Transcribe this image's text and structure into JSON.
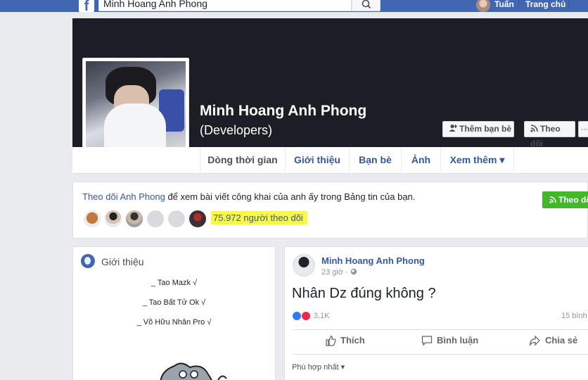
{
  "topbar": {
    "logo": "f",
    "search_value": "Minh Hoang Anh Phong",
    "user_name": "Tuấn",
    "home_label": "Trang chủ",
    "brand_color": "#4267b2"
  },
  "profile": {
    "name": "Minh Hoang Anh Phong",
    "subtitle": "(Developers)",
    "add_friend_label": "Thêm bạn bè",
    "follow_label": "Theo dõi",
    "more_label": "···"
  },
  "tabs": [
    {
      "label": "Dòng thời gian"
    },
    {
      "label": "Giới thiệu"
    },
    {
      "label": "Bạn bè"
    },
    {
      "label": "Ảnh"
    },
    {
      "label": "Xem thêm ▾"
    }
  ],
  "follow_bar": {
    "link_text": "Theo dõi Anh Phong",
    "text": " để xem bài viết công khai của anh ấy trong Bảng tin của bạn.",
    "button_label": "Theo dõi",
    "followers_text": "75.972 người theo dõi",
    "highlight_color": "#fbf74a",
    "button_color": "#42b72a"
  },
  "intro": {
    "title": "Giới thiệu",
    "lines": [
      "_ Tao Mazk √",
      "_ Tao Bất Tử Ok √",
      "_ Võ Hữu Nhân Pro √"
    ]
  },
  "post": {
    "author": "Minh Hoang Anh Phong",
    "time": "23 giờ · ",
    "text": "Nhân Dz đúng không ?",
    "reactions_count": "3,1K",
    "comments_count": "15 bình",
    "like_label": "Thích",
    "comment_label": "Bình luận",
    "share_label": "Chia sẻ",
    "sort_label": "Phù hợp nhất ▾"
  }
}
